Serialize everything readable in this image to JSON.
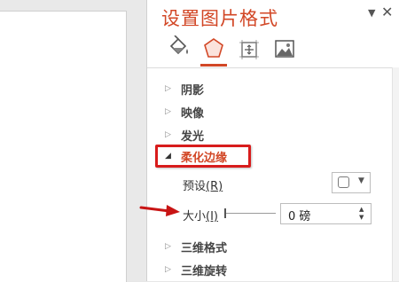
{
  "pane": {
    "title": "设置图片格式",
    "options_glyph": "▼",
    "close_glyph": "✕",
    "tabs": [
      {
        "name": "fill-line-icon"
      },
      {
        "name": "effects-icon",
        "active": true
      },
      {
        "name": "size-properties-icon"
      },
      {
        "name": "picture-icon"
      }
    ]
  },
  "sections": {
    "shadow": "阴影",
    "reflection": "映像",
    "glow": "发光",
    "soft_edges": "柔化边缘",
    "three_d_format": "三维格式",
    "three_d_rotation": "三维旋转",
    "collapsed_arrow": "▷",
    "expanded_arrow": "◢"
  },
  "soft_edges": {
    "preset_label": "预设",
    "preset_key": "(R)",
    "size_label": "大小",
    "size_key": "(I)",
    "size_value": "0 磅",
    "size_fraction": 0
  },
  "colors": {
    "accent": "#d24726",
    "annotation_red": "#d81c1c"
  }
}
